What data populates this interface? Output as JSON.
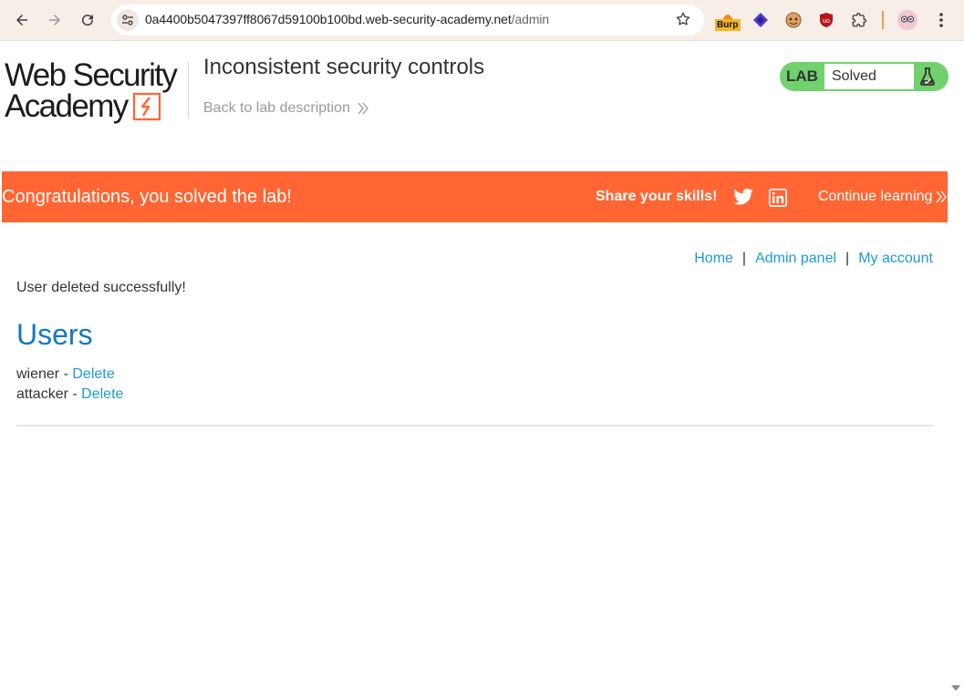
{
  "browser": {
    "url_host": "0a4400b5047397ff8067d59100b100bd.web-security-academy.net",
    "url_path": "/admin",
    "burp_label": "Burp"
  },
  "header": {
    "logo_line1": "Web Security",
    "logo_line2": "Academy",
    "lab_title": "Inconsistent security controls",
    "back_link": "Back to lab description",
    "lab_tag": "LAB",
    "lab_state": "Solved"
  },
  "banner": {
    "message": "Congratulations, you solved the lab!",
    "share_label": "Share your skills!",
    "continue_label": "Continue learning"
  },
  "nav": {
    "home": "Home",
    "separator": "|",
    "admin_panel": "Admin panel",
    "my_account": "My account"
  },
  "main": {
    "status_message": "User deleted successfully!",
    "heading": "Users",
    "users": [
      {
        "name": "wiener",
        "dash": "-",
        "action": "Delete"
      },
      {
        "name": "attacker",
        "dash": "-",
        "action": "Delete"
      }
    ]
  },
  "colors": {
    "accent": "#ff6633",
    "link": "#1b9ad8",
    "heading": "#1478bf",
    "lab_solved": "#70d16d"
  }
}
